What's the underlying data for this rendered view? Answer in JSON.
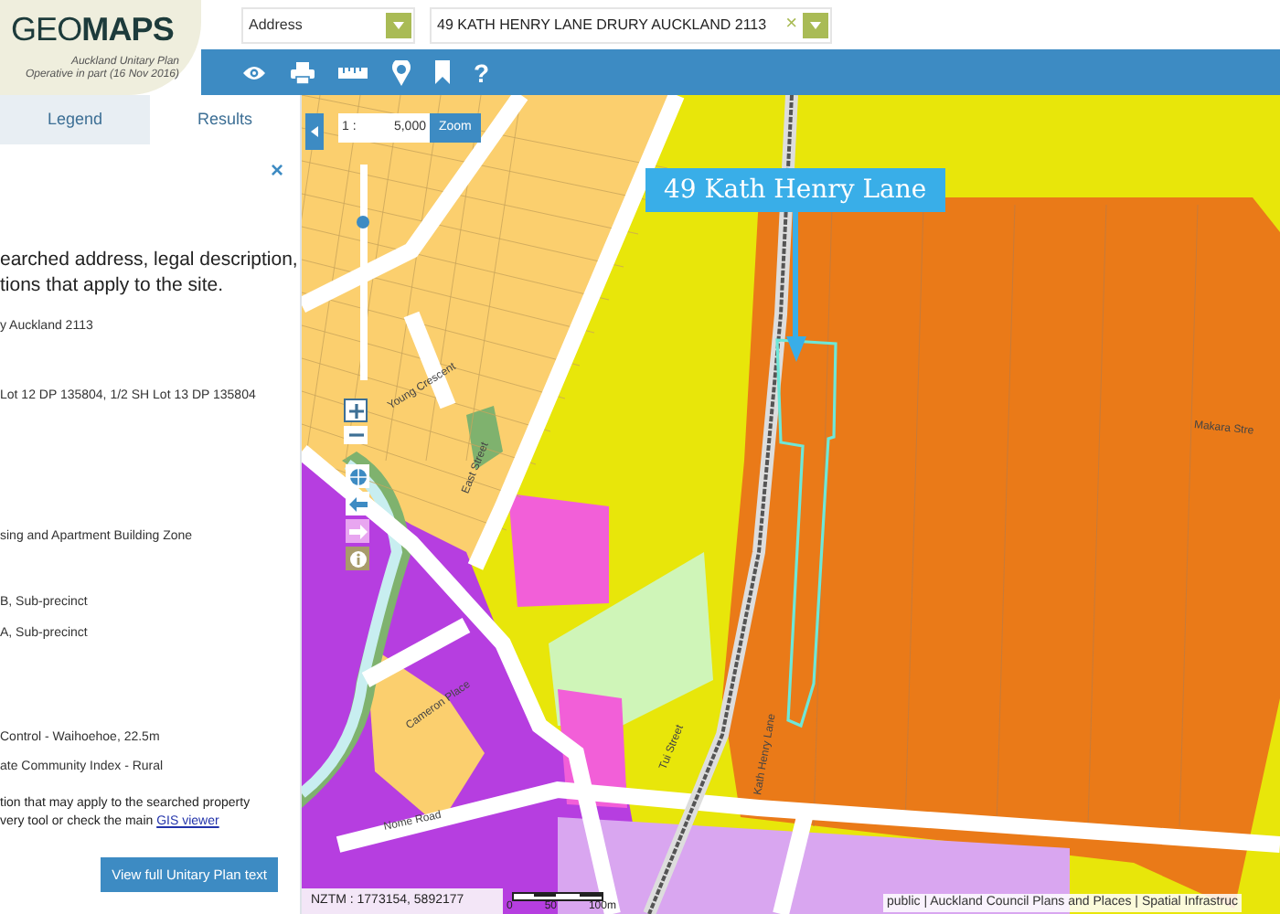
{
  "logo": {
    "title": "GEO**MAPS**",
    "subtitle": [
      "Auckland Unitary Plan",
      "Operative in part (16 Nov 2016)"
    ]
  },
  "search": {
    "type": "Address",
    "value": "49 KATH HENRY LANE DRURY AUCKLAND 2113",
    "clear": "×"
  },
  "toolbar": {
    "help": "?"
  },
  "tabs": [
    {
      "label": "Legend",
      "selected": false
    },
    {
      "label": "Results",
      "selected": true
    }
  ],
  "panel": {
    "close": "×",
    "sections": [
      {
        "kind": "heading",
        "lines": [
          "earched address, legal description,",
          "tions that apply to the site."
        ]
      },
      {
        "kind": "text",
        "lines": [
          "y Auckland 2113"
        ]
      },
      {
        "kind": "text",
        "lines": [
          "Lot 12 DP 135804, 1/2 SH Lot 13 DP 135804"
        ]
      },
      {
        "kind": "text",
        "lines": [
          "sing and Apartment Building Zone"
        ]
      },
      {
        "kind": "text",
        "lines": [
          "B, Sub-precinct",
          "A, Sub-precinct"
        ]
      },
      {
        "kind": "text",
        "lines": [
          "Control - Waihoehoe, 22.5m",
          "ate Community Index - Rural"
        ]
      },
      {
        "kind": "note",
        "lines": [
          "tion that may apply to the searched property",
          "very tool or check the main "
        ],
        "link": "GIS viewer"
      }
    ],
    "button": "View full Unitary Plan text"
  },
  "map": {
    "zoom_slider": {
      "level": 0.75
    },
    "scale_prefix": "1 :",
    "scale": "5,000",
    "zoom": "Zoom",
    "callout": "49 Kath Henry Lane",
    "streets": [
      "Young Crescent",
      "East Street",
      "Cameron Place",
      "Nome Road",
      "Tui Street",
      "Kath Henry Lane",
      "Makara Stre"
    ],
    "coords": "NZTM : 1773154, 5892177",
    "scalebar": [
      "0",
      "50",
      "100m"
    ],
    "attribution": "public | Auckland Council Plans and Places | Spatial Infrastruc"
  }
}
